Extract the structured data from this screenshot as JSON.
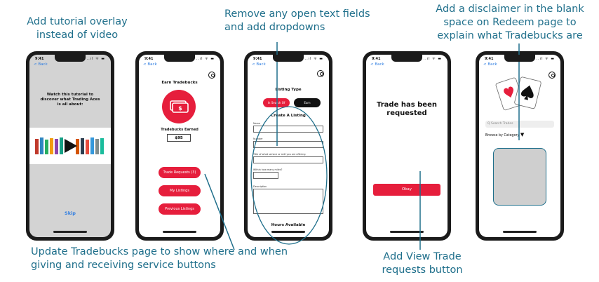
{
  "annotations": {
    "tutorial": [
      "Add tutorial overlay",
      "instead of video"
    ],
    "dropdowns": [
      "Remove any open text fields",
      "and add dropdowns"
    ],
    "disclaimer": [
      "Add a disclaimer in the blank",
      "space on Redeem page to",
      "explain what Tradebucks are"
    ],
    "tradebucks": [
      "Update Tradebucks page to show where and when",
      "giving and receiving service buttons"
    ],
    "view_trade": [
      "Add View Trade",
      "requests button"
    ]
  },
  "status_bar": {
    "time": "9:41",
    "icons": "..ıl ᯤ ▬"
  },
  "back_label": "< Back",
  "phone1": {
    "intro": "Watch this tutorial to discover what Trading Aces is all about:",
    "skip": "Skip"
  },
  "phone2": {
    "title": "Earn Tradebucks",
    "earned_label": "Tradebucks Earned",
    "earned_value": "$95",
    "buttons": [
      "Trade Requests (3)",
      "My Listings",
      "Previous Listings"
    ]
  },
  "phone3": {
    "listing_type": "Listing Type",
    "toggle": [
      "In Search Of",
      "Earn"
    ],
    "create": "Create A Listing",
    "fields": [
      "Name",
      "Number",
      "Title of what service or skill you are offering",
      "Within how many miles?",
      "Description"
    ],
    "hours": "Hours Available"
  },
  "phone4": {
    "message": "Trade has been requested",
    "okay": "Okay"
  },
  "phone5": {
    "search_placeholder": "Q Search Trades",
    "browse": "Browse by Category"
  },
  "colors": {
    "accent": "#e61e3c",
    "annotation": "#1f6f8b",
    "ios_blue": "#2f7de1"
  }
}
